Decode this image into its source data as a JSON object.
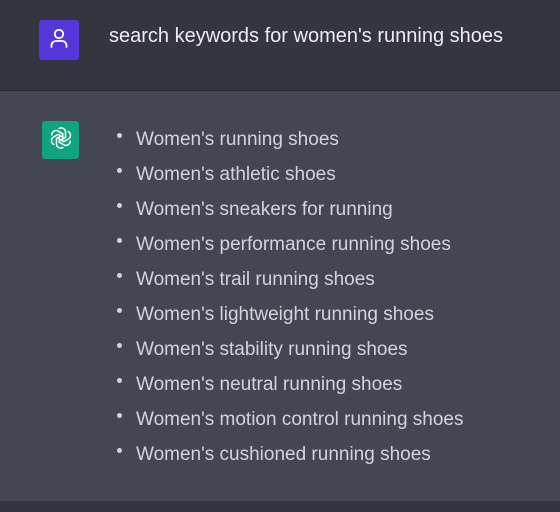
{
  "conversation": {
    "user": {
      "avatar_icon": "user-icon",
      "avatar_color": "#5436da",
      "message": "search keywords for women's running shoes"
    },
    "assistant": {
      "avatar_icon": "openai-logo-icon",
      "avatar_color": "#10a37f",
      "items": [
        "Women's running shoes",
        "Women's athletic shoes",
        "Women's sneakers for running",
        "Women's performance running shoes",
        "Women's trail running shoes",
        "Women's lightweight running shoes",
        "Women's stability running shoes",
        "Women's neutral running shoes",
        "Women's motion control running shoes",
        "Women's cushioned running shoes"
      ]
    }
  }
}
